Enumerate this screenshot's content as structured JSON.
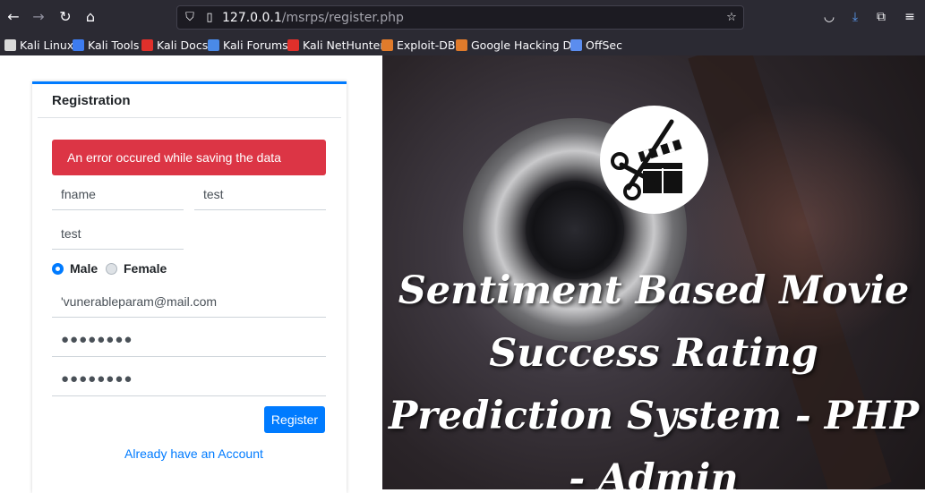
{
  "browser": {
    "url_host": "127.0.0.1",
    "url_path": "/msrps/register.php",
    "bookmarks": [
      {
        "label": "Kali Linux",
        "color": "#d9d9d9"
      },
      {
        "label": "Kali Tools",
        "color": "#3d7cf0"
      },
      {
        "label": "Kali Docs",
        "color": "#e0302b"
      },
      {
        "label": "Kali Forums",
        "color": "#4a8ae8"
      },
      {
        "label": "Kali NetHunter",
        "color": "#e0302b"
      },
      {
        "label": "Exploit-DB",
        "color": "#e07b2b"
      },
      {
        "label": "Google Hacking DB",
        "color": "#e07b2b"
      },
      {
        "label": "OffSec",
        "color": "#5b8def"
      }
    ]
  },
  "form": {
    "title": "Registration",
    "alert": "An error occured while saving the data",
    "fields": {
      "first_name": "fname",
      "middle_name": "test",
      "last_name": "test",
      "email": "'vunerableparam@mail.com",
      "password": "●●●●●●●●",
      "confirm_password": "●●●●●●●●"
    },
    "gender": {
      "options": [
        "Male",
        "Female"
      ],
      "selected": "Male"
    },
    "register_label": "Register",
    "login_link": "Already have an Account"
  },
  "hero": {
    "headline": "Sentiment Based Movie Success Rating Prediction System - PHP - Admin"
  },
  "colors": {
    "primary": "#007bff",
    "danger": "#dc3545"
  }
}
